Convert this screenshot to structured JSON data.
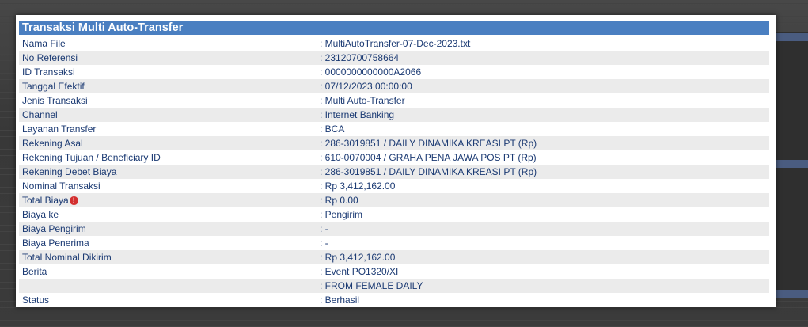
{
  "title": "Transaksi Multi Auto-Transfer",
  "rows": [
    {
      "label": "Nama File",
      "value": ": MultiAutoTransfer-07-Dec-2023.txt"
    },
    {
      "label": "No Referensi",
      "value": ": 23120700758664"
    },
    {
      "label": "ID Transaksi",
      "value": ": 0000000000000A2066"
    },
    {
      "label": "Tanggal Efektif",
      "value": ": 07/12/2023 00:00:00"
    },
    {
      "label": "Jenis Transaksi",
      "value": ": Multi Auto-Transfer"
    },
    {
      "label": "Channel",
      "value": ": Internet Banking"
    },
    {
      "label": "Layanan Transfer",
      "value": ": BCA"
    },
    {
      "label": "Rekening Asal",
      "value": ": 286-3019851 / DAILY DINAMIKA KREASI PT (Rp)"
    },
    {
      "label": "Rekening Tujuan / Beneficiary ID",
      "value": ": 610-0070004 / GRAHA PENA JAWA POS PT (Rp)"
    },
    {
      "label": "Rekening Debet Biaya",
      "value": ": 286-3019851 / DAILY DINAMIKA KREASI PT (Rp)"
    },
    {
      "label": "Nominal Transaksi",
      "value": ": Rp 3,412,162.00"
    },
    {
      "label": "Total Biaya",
      "value": ": Rp 0.00"
    },
    {
      "label": "Biaya ke",
      "value": ": Pengirim"
    },
    {
      "label": "Biaya Pengirim",
      "value": ": -"
    },
    {
      "label": "Biaya Penerima",
      "value": ": -"
    },
    {
      "label": "Total Nominal Dikirim",
      "value": ": Rp 3,412,162.00"
    },
    {
      "label": "Berita",
      "value": ": Event PO1320/XI"
    },
    {
      "label": "",
      "value": ": FROM FEMALE DAILY"
    },
    {
      "label": "Status",
      "value": ": Berhasil"
    }
  ],
  "icons": {
    "total_biaya_info": "info-alert-icon"
  },
  "colors": {
    "header_bg": "#4a7fc1",
    "text": "#1b3a73",
    "row_shade": "#ebebeb"
  }
}
